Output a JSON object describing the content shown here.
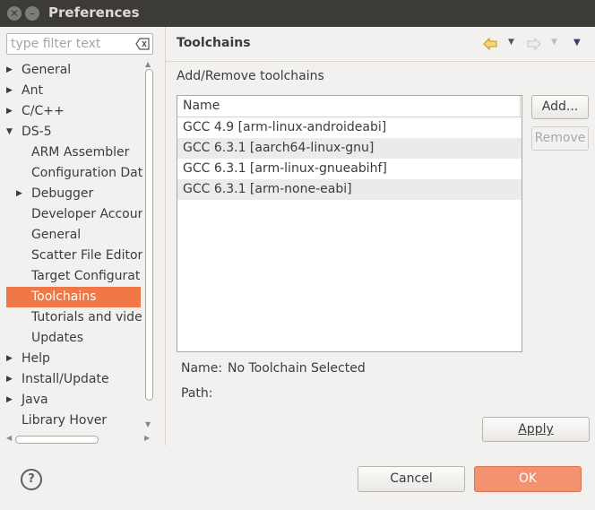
{
  "window": {
    "title": "Preferences"
  },
  "filter": {
    "placeholder": "type filter text"
  },
  "tree": [
    {
      "label": "General",
      "arrow": "▶"
    },
    {
      "label": "Ant",
      "arrow": "▶"
    },
    {
      "label": "C/C++",
      "arrow": "▶"
    },
    {
      "label": "DS-5",
      "arrow": "▼"
    },
    {
      "label": "ARM Assembler",
      "arrow": ""
    },
    {
      "label": "Configuration Dat",
      "arrow": ""
    },
    {
      "label": "Debugger",
      "arrow": "▶"
    },
    {
      "label": "Developer Accour",
      "arrow": ""
    },
    {
      "label": "General",
      "arrow": ""
    },
    {
      "label": "Scatter File Editor",
      "arrow": ""
    },
    {
      "label": "Target Configurat",
      "arrow": ""
    },
    {
      "label": "Toolchains",
      "arrow": ""
    },
    {
      "label": "Tutorials and vide",
      "arrow": ""
    },
    {
      "label": "Updates",
      "arrow": ""
    },
    {
      "label": "Help",
      "arrow": "▶"
    },
    {
      "label": "Install/Update",
      "arrow": "▶"
    },
    {
      "label": "Java",
      "arrow": "▶"
    },
    {
      "label": "Library Hover",
      "arrow": ""
    }
  ],
  "page": {
    "title": "Toolchains",
    "section_label": "Add/Remove toolchains",
    "table": {
      "column": "Name",
      "rows": [
        "GCC 4.9 [arm-linux-androideabi]",
        "GCC 6.3.1 [aarch64-linux-gnu]",
        "GCC 6.3.1 [arm-linux-gnueabihf]",
        "GCC 6.3.1 [arm-none-eabi]"
      ]
    },
    "add_label": "Add...",
    "remove_label": "Remove",
    "name_label": "Name:",
    "name_value": "No Toolchain Selected",
    "path_label": "Path:",
    "apply_label": "Apply"
  },
  "footer": {
    "help_glyph": "?",
    "cancel_label": "Cancel",
    "ok_label": "OK"
  },
  "colors": {
    "titlebar": "#3c3b37",
    "selection": "#f07746",
    "ok_button": "#f39270",
    "nav_back": "#e2a316"
  }
}
